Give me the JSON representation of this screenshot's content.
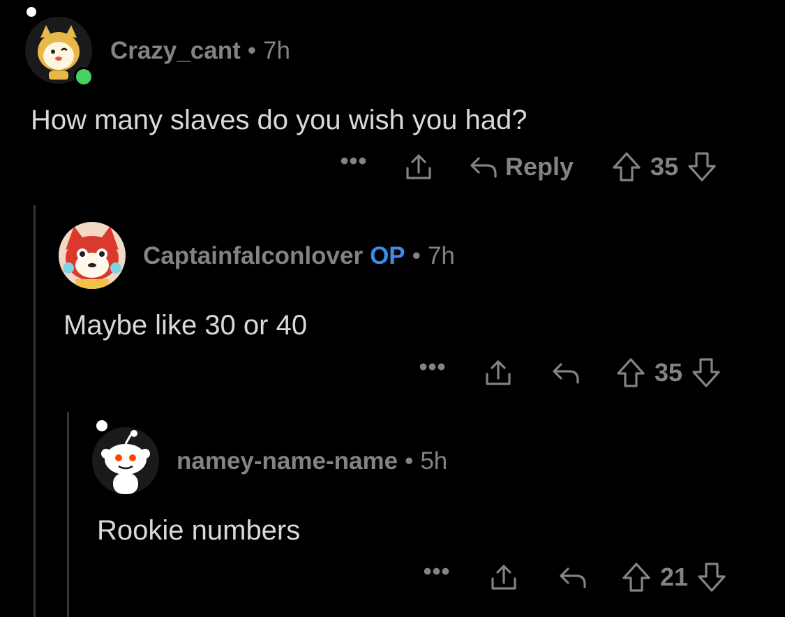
{
  "comments": [
    {
      "username": "Crazy_cant",
      "time": "7h",
      "body": "How many slaves do you wish you had?",
      "reply_label": "Reply",
      "score": "35",
      "online": true
    },
    {
      "username": "Captainfalconlover",
      "op_badge": "OP",
      "time": "7h",
      "body": "Maybe like 30 or 40",
      "score": "35"
    },
    {
      "username": "namey-name-name",
      "time": "5h",
      "body": "Rookie numbers",
      "score": "21"
    }
  ],
  "separator": "•",
  "more_glyph": "•••",
  "colors": {
    "background": "#000000",
    "text": "#d7dadc",
    "meta": "#818384",
    "op": "#3d8ce6",
    "thread_line": "#343536",
    "online": "#46d160"
  },
  "icons": [
    "more-icon",
    "share-icon",
    "reply-icon",
    "upvote-icon",
    "downvote-icon",
    "avatar-icon",
    "online-indicator"
  ]
}
